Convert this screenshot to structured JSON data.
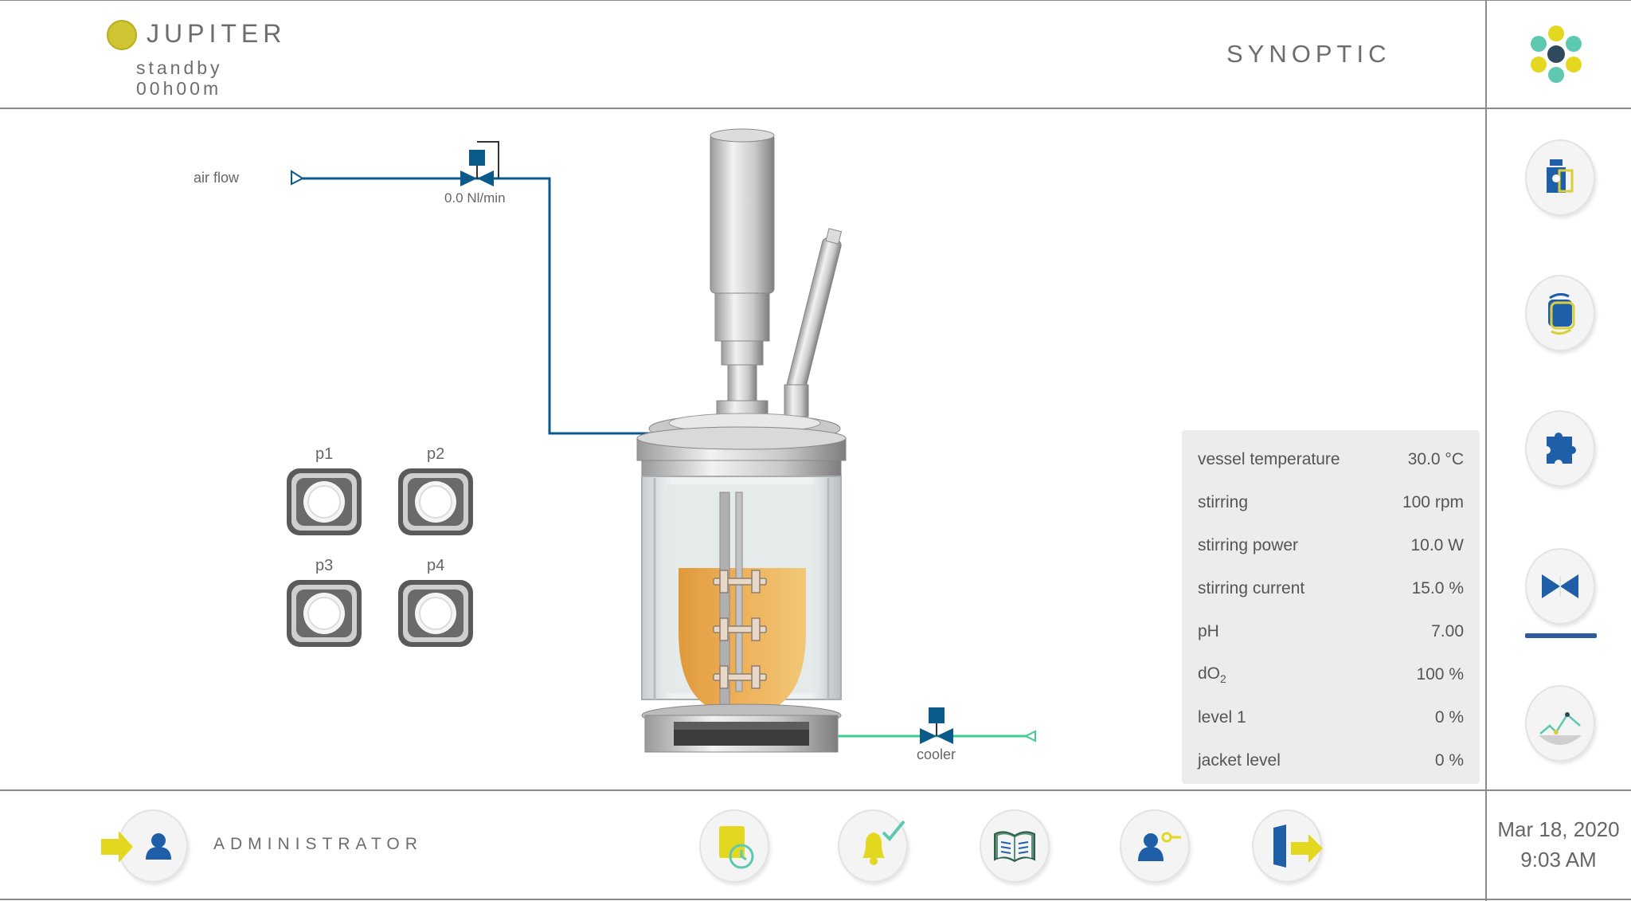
{
  "header": {
    "app_name": "JUPITER",
    "status": "standby",
    "timer": "00h00m",
    "page_title": "SYNOPTIC"
  },
  "colors": {
    "accent_yellow": "#cfc533",
    "accent_blue": "#1f5fa8",
    "valve_blue": "#0b5a8c",
    "cooler_green": "#3ecf8e",
    "liquid_orange": "#e8a94a",
    "panel_bg": "#ececec"
  },
  "side_nav": {
    "items": [
      {
        "icon": "flask-settings-icon"
      },
      {
        "icon": "cycle-icon"
      },
      {
        "icon": "puzzle-icon"
      },
      {
        "icon": "valve-icon",
        "active": true
      },
      {
        "icon": "trend-chart-icon"
      }
    ]
  },
  "diagram": {
    "air_flow_label": "air flow",
    "air_flow_value": "0.0 Nl/min",
    "cooler_label": "cooler",
    "pumps": [
      "p1",
      "p2",
      "p3",
      "p4"
    ]
  },
  "measurements": [
    {
      "label": "vessel temperature",
      "value": "30.0 °C"
    },
    {
      "label": "stirring",
      "value": "100 rpm"
    },
    {
      "label": "stirring power",
      "value": "10.0 W"
    },
    {
      "label": "stirring current",
      "value": "15.0 %"
    },
    {
      "label": "pH",
      "value": "7.00"
    },
    {
      "label_main": "dO",
      "label_sub": "2",
      "value": "100 %"
    },
    {
      "label": "level 1",
      "value": "0 %"
    },
    {
      "label": "jacket level",
      "value": "0 %"
    }
  ],
  "footer": {
    "user_role": "ADMINISTRATOR",
    "date": "Mar 18, 2020",
    "time": "9:03 AM",
    "buttons": [
      {
        "icon": "login-icon"
      },
      {
        "icon": "schedule-icon"
      },
      {
        "icon": "alarm-acknowledge-icon"
      },
      {
        "icon": "manual-icon"
      },
      {
        "icon": "user-key-icon"
      },
      {
        "icon": "exit-icon"
      }
    ]
  }
}
